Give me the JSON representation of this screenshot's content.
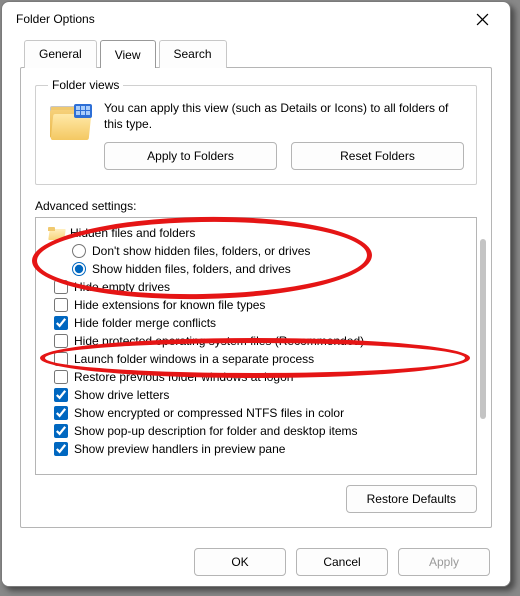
{
  "window": {
    "title": "Folder Options"
  },
  "tabs": {
    "general": "General",
    "view": "View",
    "search": "Search"
  },
  "folderViews": {
    "legend": "Folder views",
    "description": "You can apply this view (such as Details or Icons) to all folders of this type.",
    "applyBtn": "Apply to Folders",
    "resetBtn": "Reset Folders"
  },
  "advanced": {
    "label": "Advanced settings:",
    "hiddenGroup": "Hidden files and folders",
    "dontShowHidden": "Don't show hidden files, folders, or drives",
    "showHidden": "Show hidden files, folders, and drives",
    "hideEmpty": "Hide empty drives",
    "hideExt": "Hide extensions for known file types",
    "hideMerge": "Hide folder merge conflicts",
    "hideProtected": "Hide protected operating system files (Recommended)",
    "launchSeparate": "Launch folder windows in a separate process",
    "restorePrev": "Restore previous folder windows at logon",
    "showDriveLetters": "Show drive letters",
    "showEncrypted": "Show encrypted or compressed NTFS files in color",
    "showPopup": "Show pop-up description for folder and desktop items",
    "showPreview": "Show preview handlers in preview pane"
  },
  "buttons": {
    "restoreDefaults": "Restore Defaults",
    "ok": "OK",
    "cancel": "Cancel",
    "apply": "Apply"
  }
}
